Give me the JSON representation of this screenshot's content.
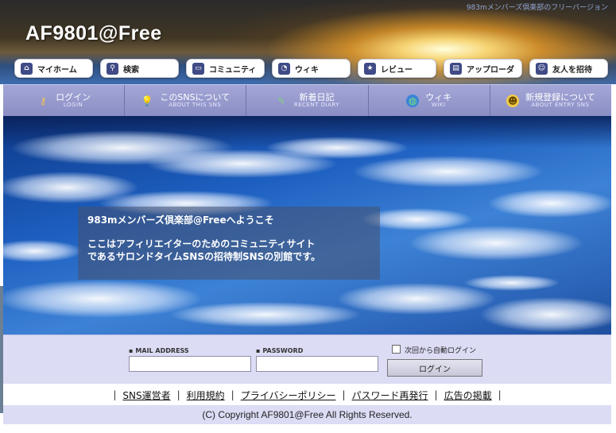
{
  "header": {
    "tagline": "983mメンバーズ倶楽部のフリーバージョン",
    "logo": "AF9801@Free"
  },
  "topnav": [
    {
      "label": "マイホーム",
      "icon": "home-icon"
    },
    {
      "label": "検索",
      "icon": "search-icon"
    },
    {
      "label": "コミュニティ",
      "icon": "chat-icon"
    },
    {
      "label": "ウィキ",
      "icon": "wiki-icon"
    },
    {
      "label": "レビュー",
      "icon": "star-icon"
    },
    {
      "label": "アップローダ",
      "icon": "upload-icon"
    },
    {
      "label": "友人を招待",
      "icon": "person-icon"
    }
  ],
  "subnav": [
    {
      "jp": "ログイン",
      "en": "LOGIN",
      "icon": "key-icon"
    },
    {
      "jp": "このSNSについて",
      "en": "ABOUT THIS SNS",
      "icon": "lightbulb-icon"
    },
    {
      "jp": "新着日記",
      "en": "RECENT DIARY",
      "icon": "diary-icon"
    },
    {
      "jp": "ウィキ",
      "en": "WIKI",
      "icon": "globe-icon"
    },
    {
      "jp": "新規登録について",
      "en": "ABOUT ENTRY SNS",
      "icon": "smiley-icon"
    }
  ],
  "welcome": {
    "title": "983mメンバーズ倶楽部@Freeへようこそ",
    "line1": "ここはアフィリエイターのためのコミュニティサイト",
    "line2": "であるサロンドタイムSNSの招待制SNSの別館です。"
  },
  "login": {
    "email_label": "MAIL ADDRESS",
    "email_value": "",
    "password_label": "PASSWORD",
    "password_value": "",
    "auto_login_label": "次回から自動ログイン",
    "submit_label": "ログイン"
  },
  "footer": {
    "links": [
      "SNS運営者",
      "利用規約",
      "プライバシーポリシー",
      "パスワード再発行",
      "広告の掲載"
    ],
    "copyright": "(C) Copyright AF9801@Free All Rights Reserved."
  },
  "colors": {
    "nav_purple": "#8b8ec4",
    "login_bg": "#dcdcf5",
    "icon_navy": "#3f4a86"
  }
}
